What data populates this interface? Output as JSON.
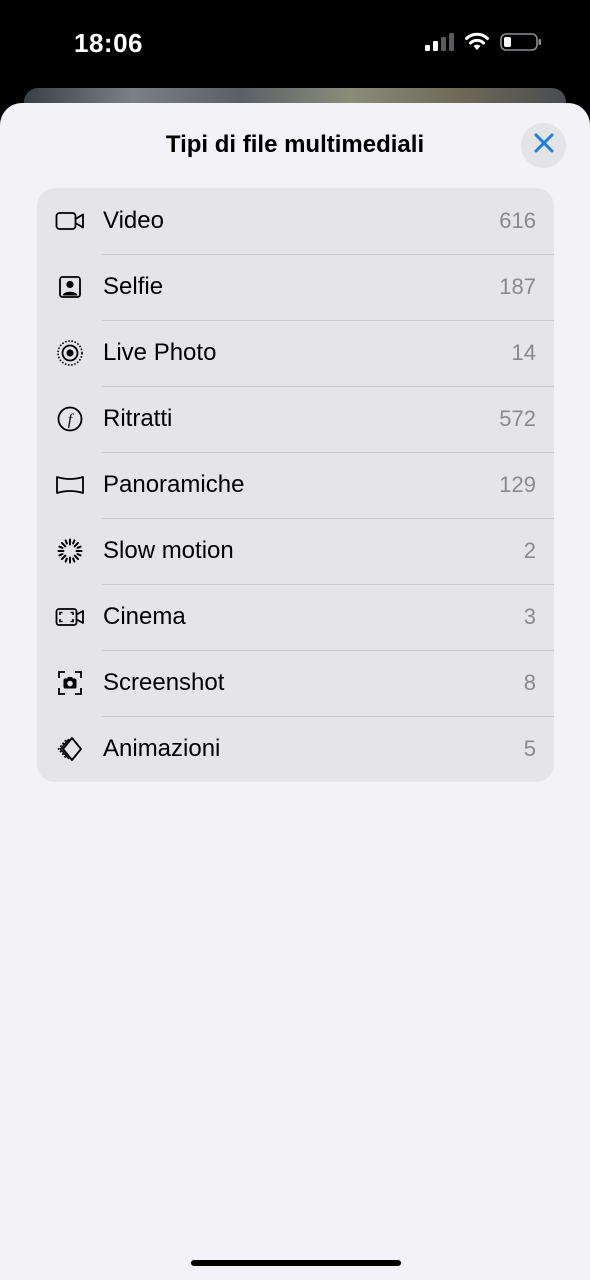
{
  "status_bar": {
    "time": "18:06",
    "signal_icon": "cellular-signal-icon",
    "wifi_icon": "wifi-icon",
    "battery_icon": "battery-icon"
  },
  "sheet": {
    "title": "Tipi di file multimediali",
    "close_icon": "close-icon",
    "accent_color": "#1a7fe6"
  },
  "media_types": [
    {
      "icon": "video-icon",
      "label": "Video",
      "count": "616"
    },
    {
      "icon": "selfie-icon",
      "label": "Selfie",
      "count": "187"
    },
    {
      "icon": "live-photo-icon",
      "label": "Live Photo",
      "count": "14"
    },
    {
      "icon": "portrait-icon",
      "label": "Ritratti",
      "count": "572"
    },
    {
      "icon": "panorama-icon",
      "label": "Panoramiche",
      "count": "129"
    },
    {
      "icon": "slow-motion-icon",
      "label": "Slow motion",
      "count": "2"
    },
    {
      "icon": "cinematic-icon",
      "label": "Cinema",
      "count": "3"
    },
    {
      "icon": "screenshot-icon",
      "label": "Screenshot",
      "count": "8"
    },
    {
      "icon": "animated-icon",
      "label": "Animazioni",
      "count": "5"
    }
  ]
}
